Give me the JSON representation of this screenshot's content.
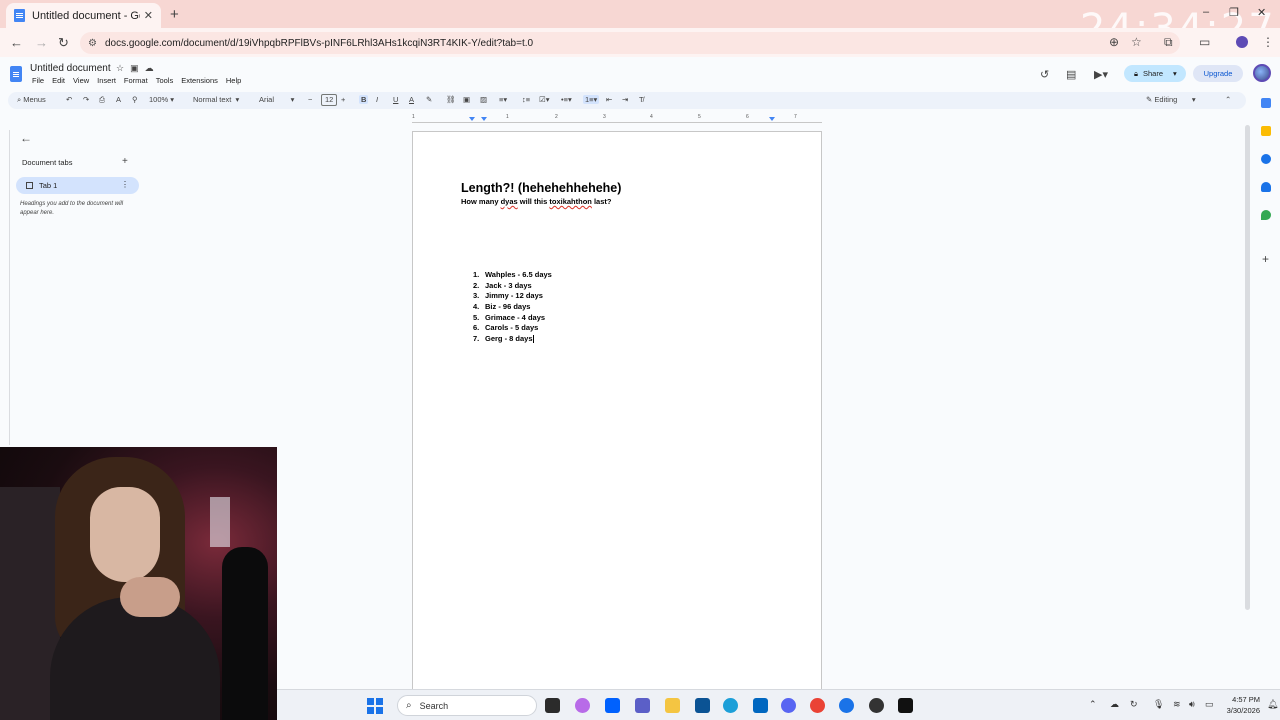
{
  "browser": {
    "tab_title": "Untitled document - Google Do",
    "tab_close": "✕",
    "new_tab": "+",
    "overlay_clock": "24:34:27",
    "url": "docs.google.com/document/d/19iVhpqbRPFlBVs-pINF6LRhl3AHs1kcqiN3RT4KIK-Y/edit?tab=t.0"
  },
  "docs": {
    "doc_title": "Untitled document",
    "menu": [
      "File",
      "Edit",
      "View",
      "Insert",
      "Format",
      "Tools",
      "Extensions",
      "Help"
    ],
    "share_label": "Share",
    "upgrade_label": "Upgrade"
  },
  "toolbar": {
    "menus_label": "Menus",
    "zoom": "100%",
    "style": "Normal text",
    "font": "Arial",
    "font_size": "12",
    "mode": "Editing"
  },
  "ruler": {
    "ticks": [
      "1",
      "1",
      "2",
      "3",
      "4",
      "5",
      "6",
      "7"
    ]
  },
  "left_panel": {
    "heading": "Document tabs",
    "tab_label": "Tab 1",
    "hint": "Headings you add to the document will appear here."
  },
  "document": {
    "title": "Length?! (hehehehhehehe)",
    "subtitle_parts": [
      "How many ",
      "dyas",
      " will this ",
      "toxikahthon",
      " last?"
    ],
    "list": [
      {
        "num": "1.",
        "text": "Wahples - 6.5 days"
      },
      {
        "num": "2.",
        "text": "Jack - 3 days"
      },
      {
        "num": "3.",
        "text": "Jimmy - 12 days"
      },
      {
        "num": "4.",
        "text": "Biz - 96 days"
      },
      {
        "num": "5.",
        "text": "Grimace - 4 days"
      },
      {
        "num": "6.",
        "text": "Carols - 5 days"
      },
      {
        "num": "7.",
        "text": "Gerg - 8 days"
      }
    ]
  },
  "taskbar": {
    "search_label": "Search",
    "time": "4:57 PM",
    "date": "3/30/2026"
  }
}
